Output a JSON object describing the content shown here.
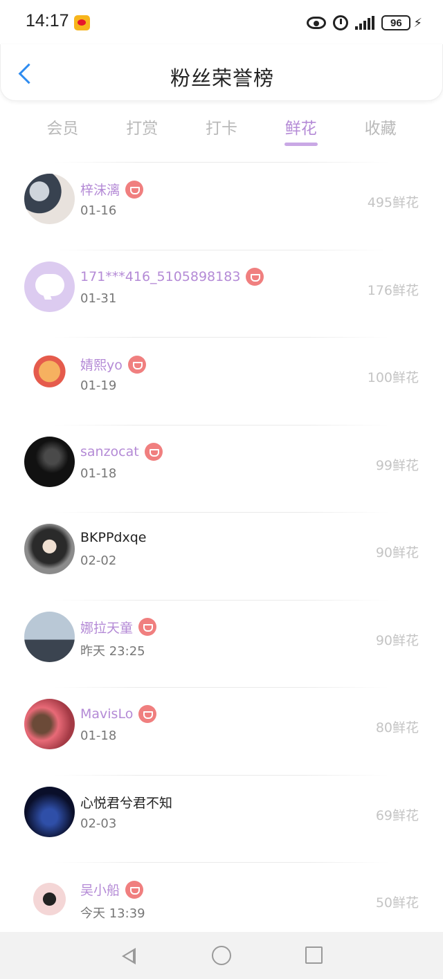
{
  "status_bar": {
    "time": "14:17",
    "battery": "96",
    "icons": [
      "weibo-icon",
      "eye-icon",
      "alarm-icon",
      "signal-icon",
      "battery-icon",
      "bolt-icon"
    ]
  },
  "header": {
    "title": "粉丝荣誉榜",
    "back_icon": "chevron-left-icon"
  },
  "tabs": [
    {
      "label": "会员",
      "active": false
    },
    {
      "label": "打赏",
      "active": false
    },
    {
      "label": "打卡",
      "active": false
    },
    {
      "label": "鲜花",
      "active": true
    },
    {
      "label": "收藏",
      "active": false
    }
  ],
  "list": [
    {
      "name": "梓沫漓",
      "date": "01-16",
      "count": "495鲜花",
      "vip": true
    },
    {
      "name": "171***416_5105898183",
      "date": "01-31",
      "count": "176鲜花",
      "vip": true
    },
    {
      "name": "婧熙yo",
      "date": "01-19",
      "count": "100鲜花",
      "vip": true
    },
    {
      "name": "sanzocat",
      "date": "01-18",
      "count": "99鲜花",
      "vip": true
    },
    {
      "name": "BKPPdxqe",
      "date": "02-02",
      "count": "90鲜花",
      "vip": false
    },
    {
      "name": "娜拉天童",
      "date": "昨天 23:25",
      "count": "90鲜花",
      "vip": true
    },
    {
      "name": "MavisLo",
      "date": "01-18",
      "count": "80鲜花",
      "vip": true
    },
    {
      "name": "心悦君兮君不知",
      "date": "02-03",
      "count": "69鲜花",
      "vip": false
    },
    {
      "name": "吴小船",
      "date": "今天 13:39",
      "count": "50鲜花",
      "vip": true
    }
  ],
  "colors": {
    "accent": "#b48ad6",
    "back_arrow": "#2f8cf0",
    "vip_badge": "#f07f7f",
    "count_text": "#c4c4c4"
  }
}
